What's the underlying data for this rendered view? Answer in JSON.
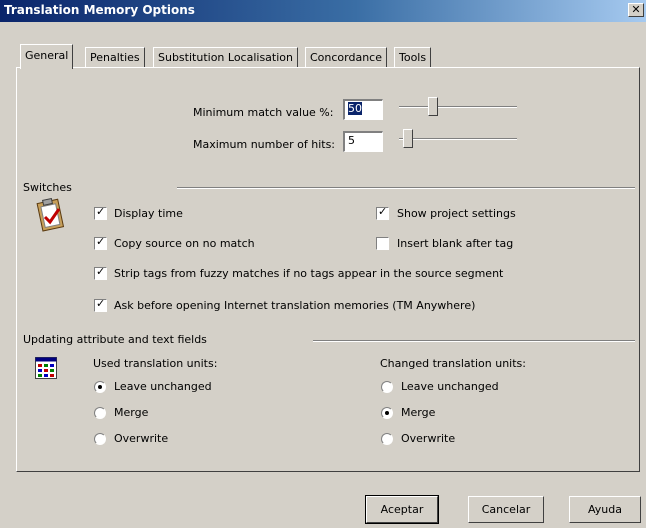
{
  "window": {
    "title": "Translation Memory Options",
    "close_glyph": "✕"
  },
  "tabs": [
    "General",
    "Penalties",
    "Substitution Localisation",
    "Concordance",
    "Tools"
  ],
  "general": {
    "min_match_label": "Minimum match value %:",
    "min_match_value": "50",
    "min_match_slider_fraction": 0.3,
    "max_hits_label": "Maximum number of hits:",
    "max_hits_value": "5",
    "max_hits_slider_fraction": 0.04
  },
  "switches": {
    "heading": "Switches",
    "icon": "clipboard-check-icon",
    "items": [
      {
        "label": "Display time",
        "checked": true
      },
      {
        "label": "Show project settings",
        "checked": true
      },
      {
        "label": "Copy source on no match",
        "checked": true
      },
      {
        "label": "Insert blank after tag",
        "checked": false
      },
      {
        "label": "Strip tags from fuzzy matches if no tags appear in the source segment",
        "checked": true
      },
      {
        "label": "Ask before opening Internet translation memories (TM Anywhere)",
        "checked": true
      }
    ]
  },
  "updating": {
    "heading": "Updating attribute and text fields",
    "icon": "grid-table-icon",
    "used": {
      "heading": "Used translation units:",
      "options": [
        {
          "label": "Leave unchanged",
          "selected": true
        },
        {
          "label": "Merge",
          "selected": false
        },
        {
          "label": "Overwrite",
          "selected": false
        }
      ]
    },
    "changed": {
      "heading": "Changed translation units:",
      "options": [
        {
          "label": "Leave unchanged",
          "selected": false
        },
        {
          "label": "Merge",
          "selected": true
        },
        {
          "label": "Overwrite",
          "selected": false
        }
      ]
    }
  },
  "buttons": {
    "ok": "Aceptar",
    "cancel": "Cancelar",
    "help": "Ayuda"
  },
  "colors": {
    "titlebar_start": "#0a246a",
    "titlebar_end": "#a6caf0",
    "dialog_face": "#d4d0c8"
  }
}
